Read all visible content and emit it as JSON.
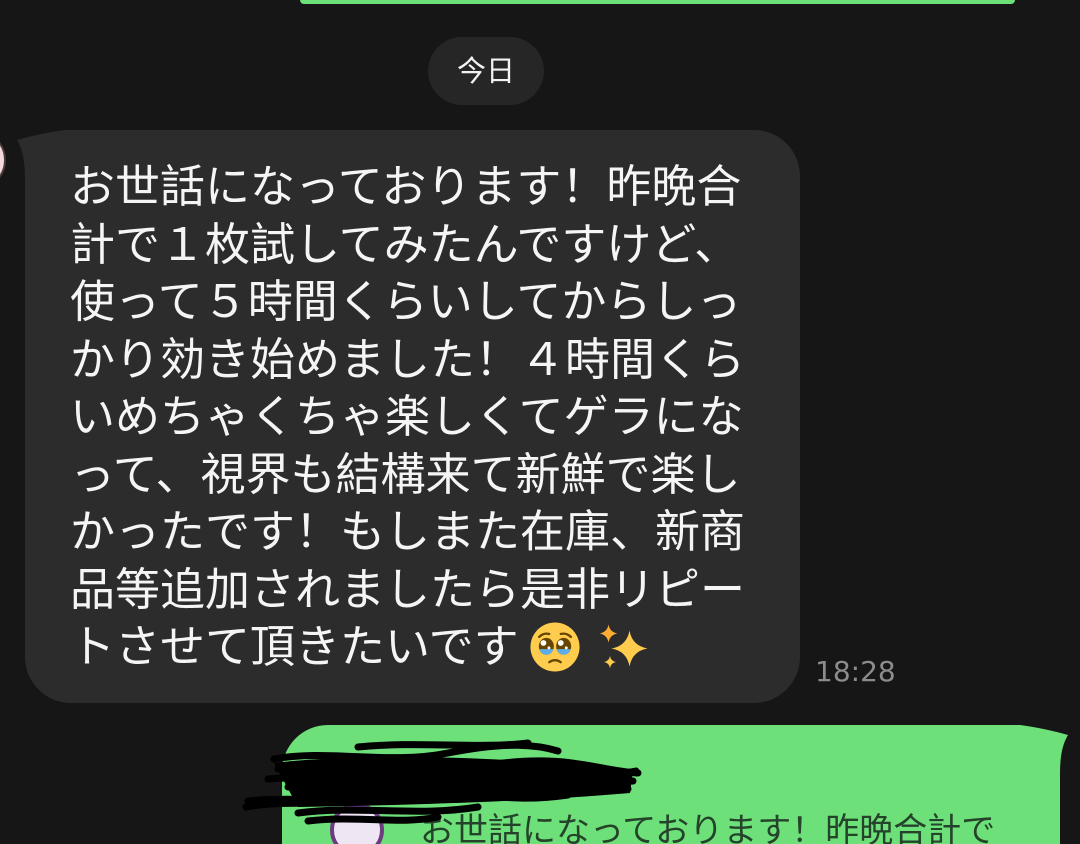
{
  "date_separator": {
    "label": "今日"
  },
  "incoming_message": {
    "lines": [
      "お世話になっております！昨晩合",
      "計で１枚試してみたんですけど、",
      "使って５時間くらいしてからしっ",
      "かり効き始めました！４時間くら",
      "いめちゃくちゃ楽しくてゲラにな",
      "って、視界も結構来て新鮮で楽し",
      "かったです！もしまた在庫、新商",
      "品等追加されましたら是非リピー",
      "トさせて頂きたいです"
    ],
    "trailing_icons": [
      "face-holding-back-tears-icon",
      "sparkles-icon"
    ],
    "time": "18:28"
  },
  "outgoing_message": {
    "reply_quote": {
      "text": "お世話になっております！昨晩合計で"
    }
  },
  "colors": {
    "background": "#161616",
    "date_pill": "#262626",
    "incoming_bubble": "#2c2c2c",
    "incoming_text": "#f5f5f5",
    "outgoing_bubble": "#6ee07a",
    "timestamp": "#8c8c8c"
  }
}
